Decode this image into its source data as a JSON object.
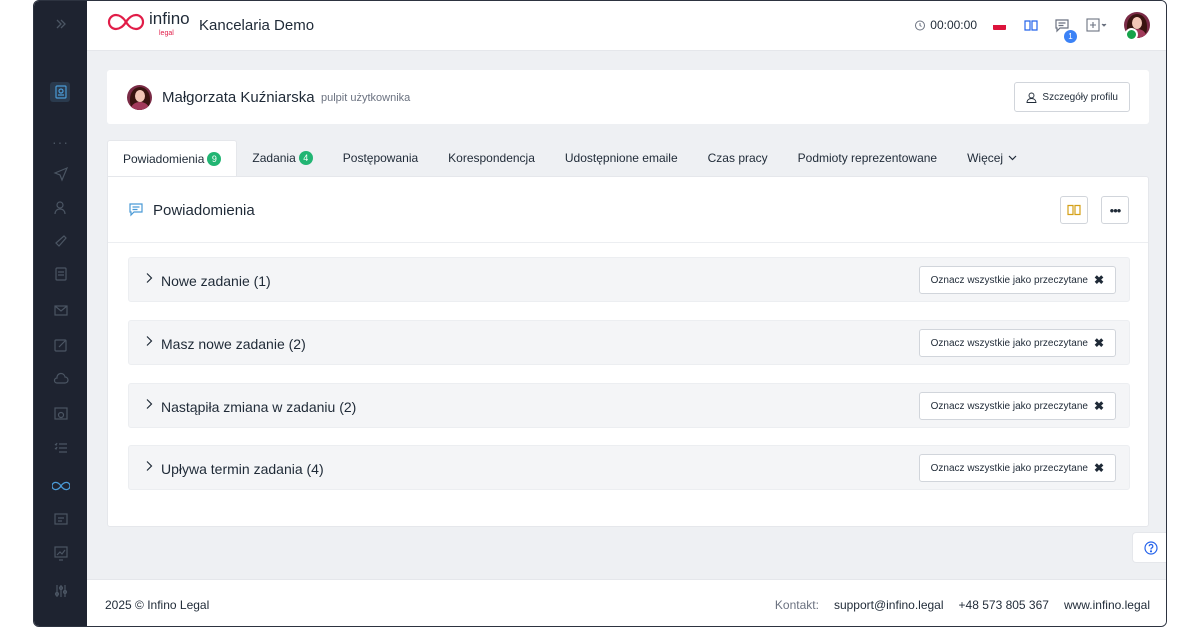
{
  "app": {
    "logo_text": "infino",
    "logo_sub": "legal",
    "title": "Kancelaria Demo"
  },
  "topbar": {
    "timer": "00:00:00",
    "messages_badge": "1"
  },
  "user": {
    "name": "Małgorzata Kuźniarska",
    "subtitle": "pulpit użytkownika",
    "profile_button": "Szczegóły profilu"
  },
  "tabs": [
    {
      "label": "Powiadomienia",
      "count": "9",
      "active": true
    },
    {
      "label": "Zadania",
      "count": "4",
      "active": false
    },
    {
      "label": "Postępowania"
    },
    {
      "label": "Korespondencja"
    },
    {
      "label": "Udostępnione emaile"
    },
    {
      "label": "Czas pracy"
    },
    {
      "label": "Podmioty reprezentowane"
    },
    {
      "label": "Więcej"
    }
  ],
  "panel": {
    "title": "Powiadomienia",
    "more_label": "•••"
  },
  "groups": [
    {
      "label": "Nowe zadanie (1)",
      "action": "Oznacz wszystkie jako przeczytane"
    },
    {
      "label": "Masz nowe zadanie (2)",
      "action": "Oznacz wszystkie jako przeczytane"
    },
    {
      "label": "Nastąpiła zmiana w zadaniu (2)",
      "action": "Oznacz wszystkie jako przeczytane"
    },
    {
      "label": "Upływa termin zadania (4)",
      "action": "Oznacz wszystkie jako przeczytane"
    }
  ],
  "footer": {
    "copyright": "2025 © Infino Legal",
    "contact_label": "Kontakt:",
    "email": "support@infino.legal",
    "phone": "+48 573 805 367",
    "website": "www.infino.legal"
  },
  "colors": {
    "sidebar_bg": "#1e2330",
    "accent_green": "#22b573",
    "badge_blue": "#3b82f6",
    "brand_red": "#e11d48",
    "icon_yellow": "#d4a017"
  },
  "icons": {
    "sidebar": [
      "expand-icon",
      "dashboard-icon",
      "more-dots",
      "paper-plane-icon",
      "users-icon",
      "megaphone-icon",
      "document-icon",
      "mail-icon",
      "edit-icon",
      "cloud-icon",
      "calendar-clock-icon",
      "checklist-icon",
      "infinity-icon",
      "folder-icon",
      "chart-icon",
      "sliders-icon"
    ]
  }
}
